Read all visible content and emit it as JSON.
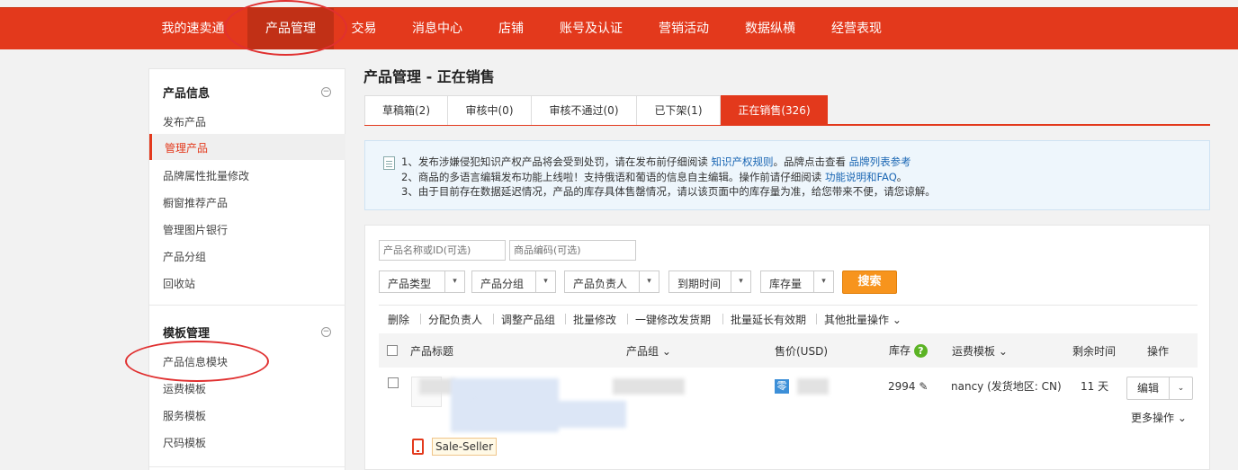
{
  "nav": {
    "items": [
      "我的速卖通",
      "产品管理",
      "交易",
      "消息中心",
      "店铺",
      "账号及认证",
      "营销活动",
      "数据纵横",
      "经营表现"
    ],
    "active": "产品管理"
  },
  "sidebar": {
    "sections": [
      {
        "title": "产品信息",
        "items": [
          "发布产品",
          "管理产品",
          "品牌属性批量修改",
          "橱窗推荐产品",
          "管理图片银行",
          "产品分组",
          "回收站"
        ]
      },
      {
        "title": "模板管理",
        "items": [
          "产品信息模块",
          "运费模板",
          "服务模板",
          "尺码模板"
        ]
      }
    ],
    "active_item": "管理产品",
    "collapse_symbol": "−"
  },
  "page": {
    "title": "产品管理 - 正在销售"
  },
  "tabs": [
    "草稿箱(2)",
    "审核中(0)",
    "审核不通过(0)",
    "已下架(1)",
    "正在销售(326)"
  ],
  "active_tab": "正在销售(326)",
  "notice": {
    "line1_text": "1、发布涉嫌侵犯知识产权产品将会受到处罚，请在发布前仔细阅读",
    "line1_link1": "知识产权规则",
    "line1_mid": "。品牌点击查看",
    "line1_link2": "品牌列表参考",
    "line2_text": "2、商品的多语言编辑发布功能上线啦！支持俄语和葡语的信息自主编辑。操作前请仔细阅读",
    "line2_link": "功能说明和FAQ",
    "line2_end": "。",
    "line3_text": "3、由于目前存在数据延迟情况，产品的库存具体售罄情况，请以该页面中的库存量为准，给您带来不便，请您谅解。"
  },
  "filters": {
    "name_placeholder": "产品名称或ID(可选)",
    "code_placeholder": "商品编码(可选)",
    "selects": [
      "产品类型",
      "产品分组",
      "产品负责人",
      "到期时间",
      "库存量"
    ],
    "search_label": "搜索"
  },
  "batch_actions": [
    "删除",
    "分配负责人",
    "调整产品组",
    "批量修改",
    "一键修改发货期",
    "批量延长有效期",
    "其他批量操作"
  ],
  "table": {
    "headers": {
      "title": "产品标题",
      "group": "产品组",
      "price": "售价(USD)",
      "stock": "库存",
      "freight": "运费模板",
      "remaining": "剩余时间",
      "ops": "操作"
    },
    "rows": [
      {
        "title_partial": "...ser...",
        "price_badge": "零",
        "stock": "2994",
        "freight": "nancy (发货地区: CN)",
        "remaining": "11 天",
        "edit": "编辑",
        "more": "更多操作",
        "seller_tag": "Sale-Seller"
      }
    ]
  },
  "icons": {
    "dropdown": "▾",
    "chevron": "⌄",
    "pencil": "✎",
    "help": "?"
  },
  "colors": {
    "brand": "#e3391c",
    "search": "#f7941d",
    "link": "#1a66b3"
  }
}
